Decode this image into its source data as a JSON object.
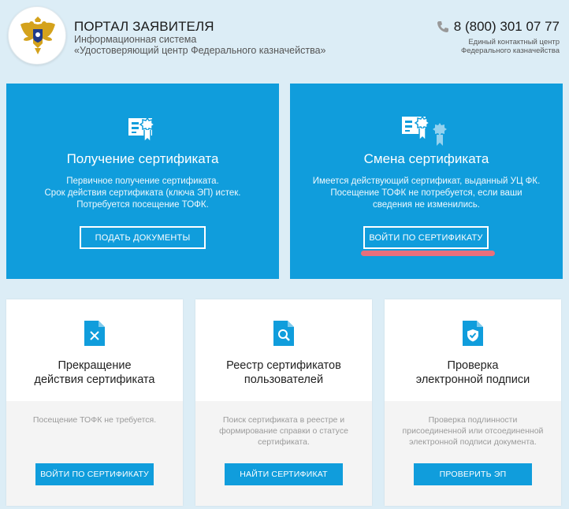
{
  "header": {
    "title": "ПОРТАЛ ЗАЯВИТЕЛЯ",
    "subtitle_line1": "Информационная система",
    "subtitle_line2": "«Удостоверяющий центр Федерального казначейства»",
    "phone": "8 (800) 301 07 77",
    "phone_caption_line1": "Единый контактный центр",
    "phone_caption_line2": "Федерального казначейства"
  },
  "cards_top": [
    {
      "title": "Получение сертификата",
      "desc": [
        "Первичное получение сертификата.",
        "Срок действия сертификата (ключа ЭП) истек.",
        "Потребуется посещение ТОФК."
      ],
      "button": "ПОДАТЬ ДОКУМЕНТЫ",
      "icon": "certificate-icon"
    },
    {
      "title": "Смена сертификата",
      "desc": [
        "Имеется действующий сертификат, выданный УЦ ФК.",
        "Посещение ТОФК не потребуется, если ваши",
        "сведения не изменились."
      ],
      "button": "ВОЙТИ ПО СЕРТИФИКАТУ",
      "icon": "certificate-change-icon"
    }
  ],
  "cards_bottom": [
    {
      "title": [
        "Прекращение",
        "действия сертификата"
      ],
      "desc": [
        "Посещение ТОФК не требуется."
      ],
      "button": "ВОЙТИ ПО СЕРТИФИКАТУ",
      "icon": "document-close-icon"
    },
    {
      "title": [
        "Реестр сертификатов",
        "пользователей"
      ],
      "desc": [
        "Поиск сертификата в реестре и",
        "формирование справки о статусе",
        "сертификата."
      ],
      "button": "НАЙТИ СЕРТИФИКАТ",
      "icon": "document-search-icon"
    },
    {
      "title": [
        "Проверка",
        "электронной подписи"
      ],
      "desc": [
        "Проверка подлинности",
        "присоединенной или отсоединенной",
        "электронной подписи документа."
      ],
      "button": "ПРОВЕРИТЬ ЭП",
      "icon": "document-shield-icon"
    }
  ],
  "colors": {
    "page_bg": "#dcedf6",
    "accent": "#109ddc",
    "highlight": "#e86f7c",
    "emblem_gold": "#d4a21c"
  }
}
